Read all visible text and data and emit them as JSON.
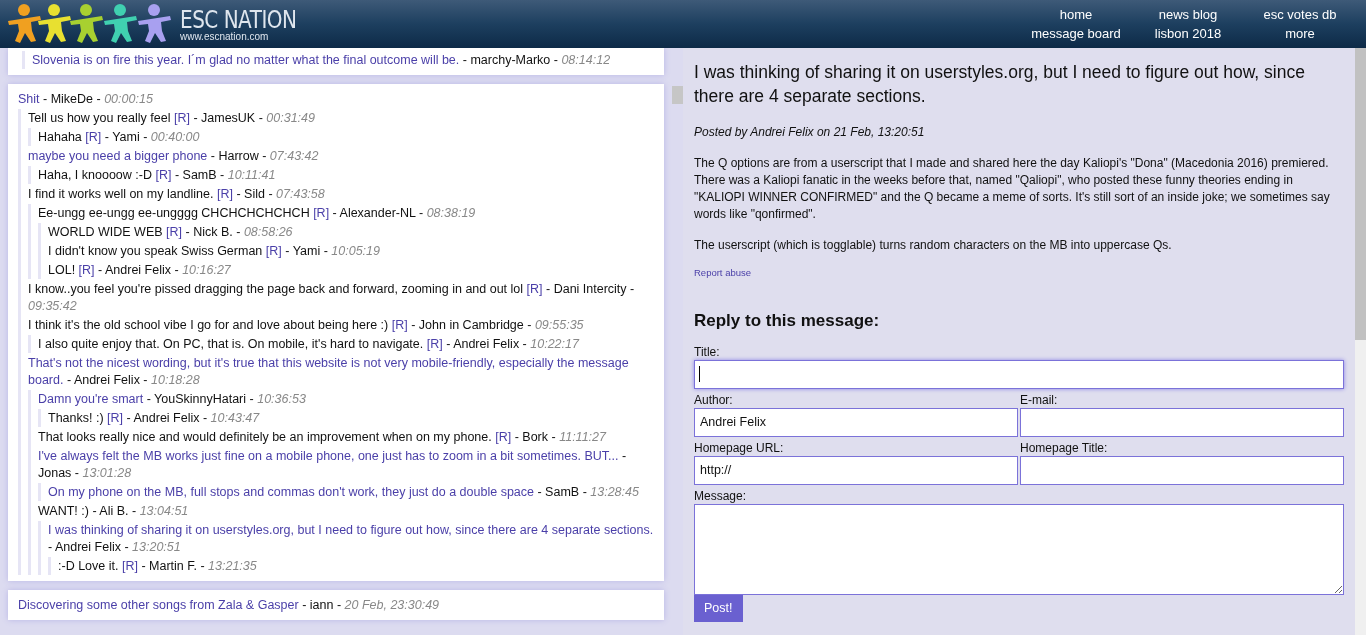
{
  "header": {
    "logo_title": "ESC NATION",
    "logo_url": "www.escnation.com",
    "nav": [
      [
        "home",
        "message board"
      ],
      [
        "news blog",
        "lisbon 2018"
      ],
      [
        "esc votes db",
        "more"
      ]
    ]
  },
  "thread_top": {
    "posts": [
      {
        "title": "Slovenia is on fire this year. I´m glad no matter what the final outcome will be.",
        "kind": "link",
        "byline": "- marchy-Marko -",
        "time": "08:14:12"
      }
    ]
  },
  "thread": {
    "posts": [
      {
        "title": "Shit",
        "kind": "link",
        "byline": "- MikeDe -",
        "time": "00:00:15",
        "children": [
          {
            "title": "Tell us how you really feel",
            "kind": "plain",
            "tag": "[R]",
            "byline": "- JamesUK -",
            "time": "00:31:49",
            "children": [
              {
                "title": "Hahaha",
                "kind": "plain",
                "tag": "[R]",
                "byline": "- Yami -",
                "time": "00:40:00"
              }
            ]
          },
          {
            "title": "maybe you need a bigger phone",
            "kind": "link",
            "byline": "- Harrow -",
            "time": "07:43:42",
            "children": [
              {
                "title": "Haha, I knoooow :-D",
                "kind": "plain",
                "tag": "[R]",
                "byline": "- SamB -",
                "time": "10:11:41"
              }
            ]
          },
          {
            "title": "I find it works well on my landline.",
            "kind": "plain",
            "tag": "[R]",
            "byline": "- Sild -",
            "time": "07:43:58",
            "children": [
              {
                "title": "Ee-ungg ee-ungg ee-ungggg CHCHCHCHCHCH",
                "kind": "plain",
                "tag": "[R]",
                "byline": "- Alexander-NL -",
                "time": "08:38:19",
                "children": [
                  {
                    "title": "WORLD WIDE WEB",
                    "kind": "plain",
                    "tag": "[R]",
                    "byline": "- Nick B. -",
                    "time": "08:58:26"
                  },
                  {
                    "title": "I didn't know you speak Swiss German",
                    "kind": "plain",
                    "tag": "[R]",
                    "byline": "- Yami -",
                    "time": "10:05:19"
                  },
                  {
                    "title": "LOL!",
                    "kind": "plain",
                    "tag": "[R]",
                    "byline": "- Andrei Felix -",
                    "time": "10:16:27"
                  }
                ]
              }
            ]
          },
          {
            "title": "I know..you feel you're pissed dragging the page back and forward, zooming in and out lol",
            "kind": "plain",
            "tag": "[R]",
            "byline": "- Dani Intercity -",
            "time": "09:35:42"
          },
          {
            "title": "I think it's the old school vibe I go for and love about being here :)",
            "kind": "plain",
            "tag": "[R]",
            "byline": "- John in Cambridge -",
            "time": "09:55:35",
            "children": [
              {
                "title": "I also quite enjoy that. On PC, that is. On mobile, it's hard to navigate.",
                "kind": "plain",
                "tag": "[R]",
                "byline": "- Andrei Felix -",
                "time": "10:22:17"
              }
            ]
          },
          {
            "title": "That's not the nicest wording, but it's true that this website is not very mobile-friendly, especially the message board.",
            "kind": "link",
            "byline": "- Andrei Felix -",
            "time": "10:18:28",
            "children": [
              {
                "title": "Damn you're smart",
                "kind": "link",
                "byline": "- YouSkinnyHatari -",
                "time": "10:36:53",
                "children": [
                  {
                    "title": "Thanks! :)",
                    "kind": "plain",
                    "tag": "[R]",
                    "byline": "- Andrei Felix -",
                    "time": "10:43:47"
                  }
                ]
              },
              {
                "title": "That looks really nice and would definitely be an improvement when on my phone.",
                "kind": "plain",
                "tag": "[R]",
                "byline": "- Bork -",
                "time": "11:11:27"
              },
              {
                "title": "I've always felt the MB works just fine on a mobile phone, one just has to zoom in a bit sometimes. BUT...",
                "kind": "link",
                "byline": "- Jonas -",
                "time": "13:01:28",
                "children": [
                  {
                    "title": "On my phone on the MB, full stops and commas don't work, they just do a double space",
                    "kind": "link",
                    "byline": "- SamB -",
                    "time": "13:28:45"
                  }
                ]
              },
              {
                "title": "WANT! :)",
                "kind": "plain",
                "byline": "- Ali B. -",
                "time": "13:04:51",
                "children": [
                  {
                    "title": "I was thinking of sharing it on userstyles.org, but I need to figure out how, since there are 4 separate sections.",
                    "kind": "link",
                    "byline": "- Andrei Felix -",
                    "time": "13:20:51",
                    "children": [
                      {
                        "title": ":-D Love it.",
                        "kind": "plain",
                        "tag": "[R]",
                        "byline": "- Martin F. -",
                        "time": "13:21:35"
                      }
                    ]
                  }
                ]
              }
            ]
          }
        ]
      }
    ]
  },
  "thread_bottom": {
    "posts": [
      {
        "title": "Discovering some other songs from Zala & Gasper",
        "kind": "link",
        "byline": "- iann -",
        "time": "20 Feb, 23:30:49"
      }
    ]
  },
  "message": {
    "title": "I was thinking of sharing it on userstyles.org, but I need to figure out how, since there are 4 separate sections.",
    "posted_by": "Posted by Andrei Felix on 21 Feb, 13:20:51",
    "paragraphs": [
      "The Q options are from a userscript that I made and shared here the day Kaliopi's \"Dona\" (Macedonia 2016) premiered. There was a Kaliopi fanatic in the weeks before that, named \"Qaliopi\", who posted these funny theories ending in \"KALIOPI WINNER CONFIRMED\" and the Q became a meme of sorts. It's still sort of an inside joke; we sometimes say words like \"qonfirmed\".",
      "The userscript (which is togglable) turns random characters on the MB into uppercase Qs."
    ],
    "report_link": "Report abuse"
  },
  "reply_form": {
    "heading": "Reply to this message:",
    "title_field": {
      "label": "Title:",
      "focused": true
    },
    "rows": [
      [
        {
          "label": "Author:",
          "value": "Andrei Felix"
        },
        {
          "label": "E-mail:"
        }
      ],
      [
        {
          "label": "Homepage URL:",
          "value": "http://"
        },
        {
          "label": "Homepage Title:"
        }
      ]
    ],
    "message_label": "Message:",
    "submit": "Post!"
  }
}
